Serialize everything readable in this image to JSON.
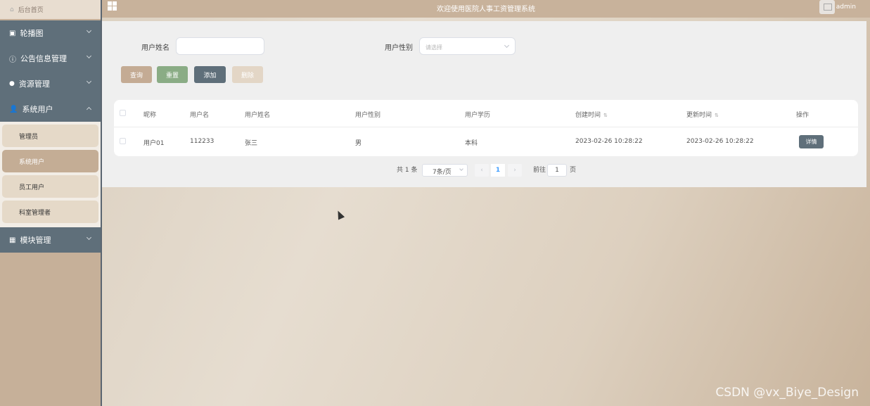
{
  "header": {
    "title": "欢迎使用医院人事工资管理系统",
    "user": "admin"
  },
  "sidebar": {
    "home": "后台首页",
    "menus": [
      {
        "label": "轮播图"
      },
      {
        "label": "公告信息管理"
      },
      {
        "label": "资源管理"
      },
      {
        "label": "系统用户"
      },
      {
        "label": "模块管理"
      }
    ],
    "submenu": [
      "管理员",
      "系统用户",
      "员工用户",
      "科室管理者"
    ],
    "active_submenu": "系统用户"
  },
  "search": {
    "name_label": "用户姓名",
    "name_value": "",
    "gender_label": "用户性别",
    "gender_placeholder": "请选择"
  },
  "actions": {
    "query": "查询",
    "reset": "重置",
    "add": "添加",
    "delete": "删除"
  },
  "table": {
    "columns": [
      "昵称",
      "用户名",
      "用户姓名",
      "用户性别",
      "用户学历",
      "创建时间",
      "更新时间",
      "操作"
    ],
    "rows": [
      {
        "nickname": "用户01",
        "username": "112233",
        "realname": "张三",
        "gender": "男",
        "education": "本科",
        "created": "2023-02-26 10:28:22",
        "updated": "2023-02-26 10:28:22",
        "action": "详情"
      }
    ]
  },
  "pagination": {
    "total": "共 1 条",
    "page_size": "7条/页",
    "current_page": "1",
    "goto_label": "前往",
    "goto_value": "1",
    "page_suffix": "页"
  },
  "watermark": "CSDN @vx_Biye_Design"
}
